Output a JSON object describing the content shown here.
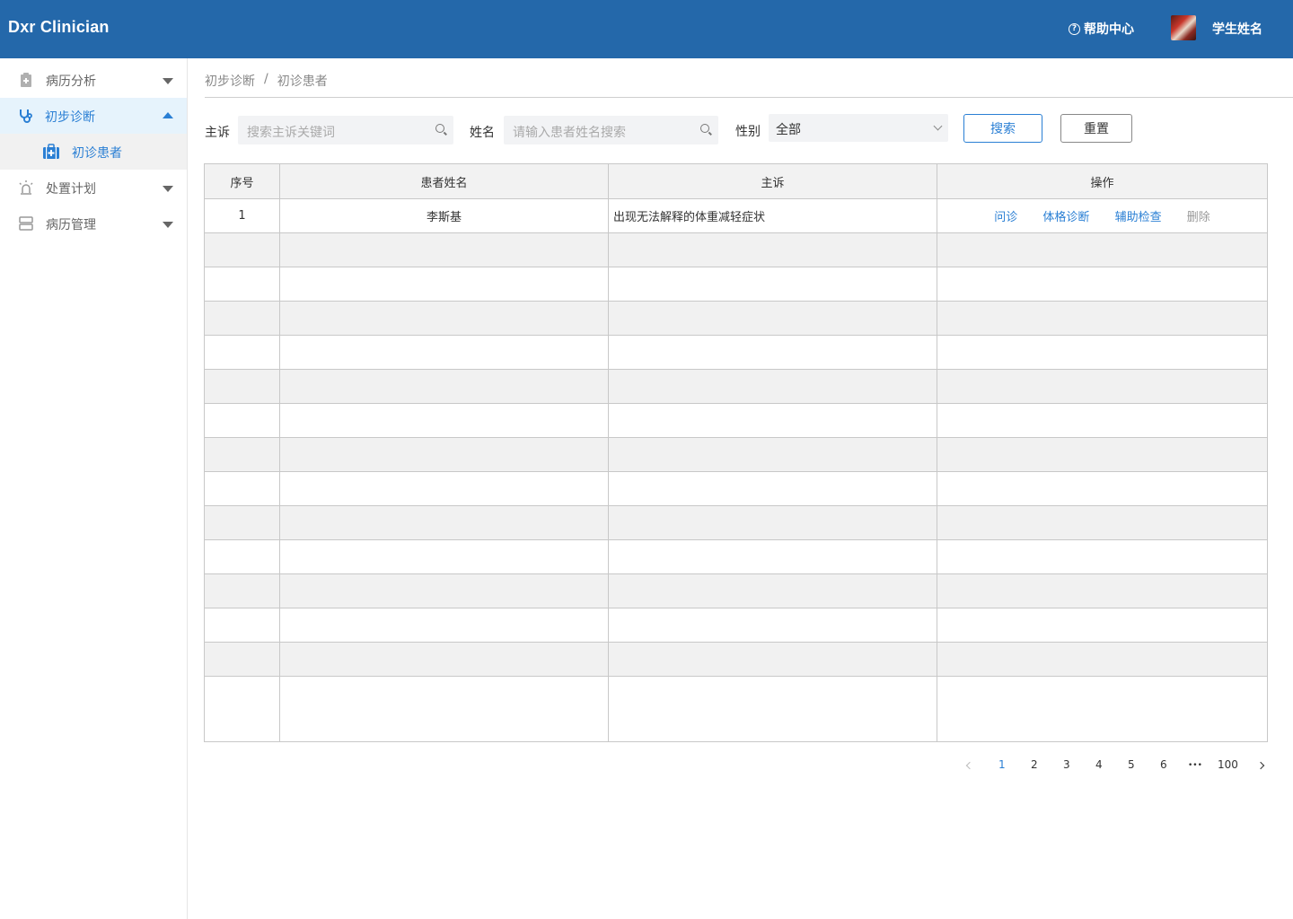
{
  "header": {
    "app_name": "Dxr Clinician",
    "help_icon": "question-circle-icon",
    "help_label": "帮助中心",
    "username": "学生姓名"
  },
  "sidebar": {
    "items": [
      {
        "label": "病历分析",
        "icon": "clipboard-medical-icon",
        "expanded": false
      },
      {
        "label": "初步诊断",
        "icon": "stethoscope-icon",
        "expanded": true
      },
      {
        "label": "初诊患者",
        "icon": "medical-kit-icon",
        "submenu": true,
        "active": true
      },
      {
        "label": "处置计划",
        "icon": "alarm-light-icon",
        "expanded": false
      },
      {
        "label": "病历管理",
        "icon": "server-icon",
        "expanded": false
      }
    ]
  },
  "breadcrumb": {
    "items": [
      "初步诊断",
      "初诊患者"
    ],
    "separator": "/"
  },
  "filters": {
    "complaint_label": "主诉",
    "complaint_placeholder": "搜索主诉关键词",
    "name_label": "姓名",
    "name_placeholder": "请输入患者姓名搜索",
    "gender_label": "性别",
    "gender_value": "全部",
    "search_button": "搜索",
    "reset_button": "重置"
  },
  "table": {
    "columns": [
      "序号",
      "患者姓名",
      "主诉",
      "操作"
    ],
    "rows": [
      {
        "index": "1",
        "name": "李斯基",
        "complaint": "出现无法解释的体重减轻症状",
        "actions": [
          "问诊",
          "体格诊断",
          "辅助检查",
          "删除"
        ]
      }
    ]
  },
  "pagination": {
    "pages": [
      "1",
      "2",
      "3",
      "4",
      "5",
      "6"
    ],
    "ellipsis": "•••",
    "last_page": "100",
    "current": "1"
  },
  "colors": {
    "header_bg": "#2468aa",
    "accent": "#2a7fd4",
    "active_bg": "#e6f3fc"
  }
}
